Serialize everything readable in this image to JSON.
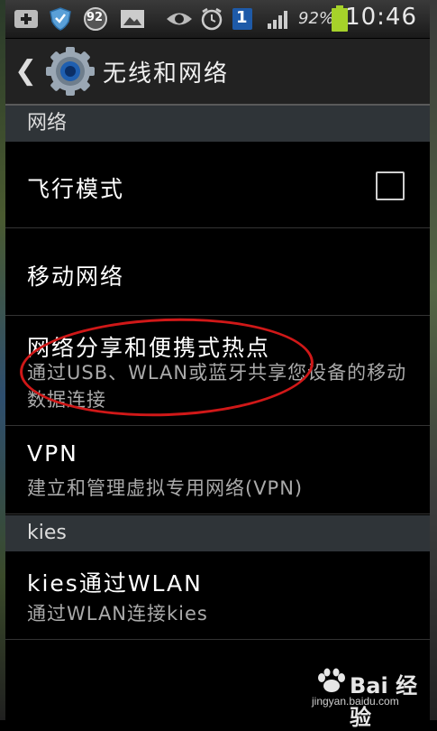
{
  "statusbar": {
    "icons": [
      "add-icon",
      "shield-icon",
      "badge-92-icon",
      "image-icon",
      "eye-icon",
      "alarm-icon",
      "notification-1-icon",
      "signal-icon",
      "battery-icon"
    ],
    "badge_count": "92",
    "notification_count": "1",
    "battery_percent": "92%",
    "time": "10:46",
    "battery_color": "#a6d22a"
  },
  "actionbar": {
    "title": "无线和网络"
  },
  "sections": [
    {
      "header": "网络",
      "items": [
        {
          "title": "飞行模式",
          "subtitle": "",
          "checkbox": false
        },
        {
          "title": "移动网络",
          "subtitle": ""
        },
        {
          "title": "网络分享和便携式热点",
          "subtitle": "通过USB、WLAN或蓝牙共享您设备的移动数据连接",
          "highlighted": true
        },
        {
          "title": "VPN",
          "subtitle": "建立和管理虚拟专用网络(VPN)"
        }
      ]
    },
    {
      "header": "kies",
      "items": [
        {
          "title": "kies通过WLAN",
          "subtitle": "通过WLAN连接kies"
        }
      ]
    }
  ],
  "watermark": {
    "text": "Bai 经验",
    "url": "jingyan.baidu.com"
  },
  "highlight_color": "#d01818"
}
